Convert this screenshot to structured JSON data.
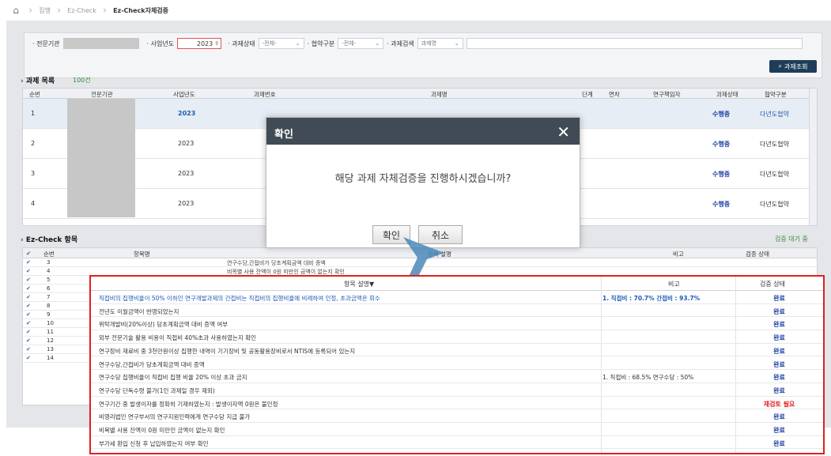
{
  "breadcrumb": {
    "items": [
      "집행",
      "Ez-Check"
    ],
    "current": "Ez-Check자체검증"
  },
  "search": {
    "org_label": "전문기관",
    "year_label": "사업년도",
    "year_value": "2023",
    "status_label": "과제상태",
    "status_value": "-전체-",
    "agreement_label": "협약구분",
    "agreement_value": "-전체-",
    "keyword_label": "과제검색",
    "keyword_type": "과제명",
    "search_button": "과제조회"
  },
  "project_list": {
    "title": "과제 목록",
    "count": "100건",
    "columns": [
      "순번",
      "전문기관",
      "사업년도",
      "과제번호",
      "과제명",
      "단계",
      "연차",
      "연구책임자",
      "과제상태",
      "협약구분"
    ],
    "rows": [
      {
        "no": "1",
        "year": "2023",
        "status": "수행중",
        "agreement": "다년도협약"
      },
      {
        "no": "2",
        "year": "2023",
        "status": "수행중",
        "agreement": "다년도협약"
      },
      {
        "no": "3",
        "year": "2023",
        "status": "수행중",
        "agreement": "다년도협약"
      },
      {
        "no": "4",
        "year": "2023",
        "status": "수행중",
        "agreement": "다년도협약"
      }
    ]
  },
  "ez_check": {
    "title": "Ez-Check 항목",
    "status_text": "검증 대기 중",
    "columns": [
      "순번",
      "항목명",
      "항목 설명",
      "비고",
      "검증 상태"
    ],
    "rows": [
      {
        "no": "3",
        "text": "연구수당,간접비가 당초계획금액 대비 증액"
      },
      {
        "no": "4",
        "text": "비목별 사용 잔액이 0원 미만인 금액이 없는지 확인"
      },
      {
        "no": "5",
        "text": ""
      },
      {
        "no": "6",
        "text": ""
      },
      {
        "no": "7",
        "text": ""
      },
      {
        "no": "8",
        "text": ""
      },
      {
        "no": "9",
        "text": ""
      },
      {
        "no": "10",
        "text": ""
      },
      {
        "no": "11",
        "text": ""
      },
      {
        "no": "12",
        "text": ""
      },
      {
        "no": "13",
        "text": ""
      },
      {
        "no": "14",
        "text": ""
      }
    ]
  },
  "dialog": {
    "title": "확인",
    "message": "해당 과제 자체검증을 진행하시겠습니까?",
    "confirm": "확인",
    "cancel": "취소"
  },
  "zoom": {
    "col_item": "항목 설명▼",
    "col_note": "비고",
    "col_status": "검증 상태",
    "rows": [
      {
        "item": "직접비의 집행비율이 50% 이하인 연구개발과제의 간접비는 직접비의 집행비율에 비례하여 인정, 초과금액은 회수",
        "note": "1. 직접비 : 70.7% 간접비 : 93.7%",
        "status": "완료",
        "highlight": true,
        "warn": false
      },
      {
        "item": "전년도 이월금액이 반영되었는지",
        "note": "",
        "status": "완료",
        "highlight": false,
        "warn": false
      },
      {
        "item": "위탁개발비(20%이상) 당초계획금액 대비 증액 여부",
        "note": "",
        "status": "완료",
        "highlight": false,
        "warn": false
      },
      {
        "item": "외부 전문기술 활용 비용이 직접비 40%초과 사용하였는지 확인",
        "note": "",
        "status": "완료",
        "highlight": false,
        "warn": false
      },
      {
        "item": "연구장비 재료비 중 3천만원이상 집행한 내역이 기기장비 및 공동활용장비로서 NTIS에 등록되어 있는지",
        "note": "",
        "status": "완료",
        "highlight": false,
        "warn": false
      },
      {
        "item": "연구수당,간접비가 당초계획금액 대비 증액",
        "note": "",
        "status": "완료",
        "highlight": false,
        "warn": false
      },
      {
        "item": "연구수당 집행비율이 직접비 집행 비율 20% 이상 초과 금지",
        "note": "1. 직접비 : 68.5% 연구수당 : 50%",
        "status": "완료",
        "highlight": false,
        "warn": false
      },
      {
        "item": "연구수당 단독수령 불가(1인 과제일 경우 제외)",
        "note": "",
        "status": "완료",
        "highlight": false,
        "warn": false
      },
      {
        "item": "연구기간 중 발생이자를 정확히 기재하였는지 : 발생이자액 0원은 불인정",
        "note": "",
        "status": "재검토 필요",
        "highlight": false,
        "warn": true
      },
      {
        "item": "비영리법인 연구부서의 연구지원인력에게 연구수당 지급 불가",
        "note": "",
        "status": "완료",
        "highlight": false,
        "warn": false
      },
      {
        "item": "비목별 사용 잔액이 0원 미만인 금액이 없는지 확인",
        "note": "",
        "status": "완료",
        "highlight": false,
        "warn": false
      },
      {
        "item": "부가세 환입 신청 후 납입하였는지 여부 확인",
        "note": "",
        "status": "완료",
        "highlight": false,
        "warn": false
      }
    ]
  },
  "colors": {
    "accent": "#1f3d5a",
    "highlight": "#e02020",
    "link": "#1d5ab5",
    "dialog_header": "#414b55"
  }
}
